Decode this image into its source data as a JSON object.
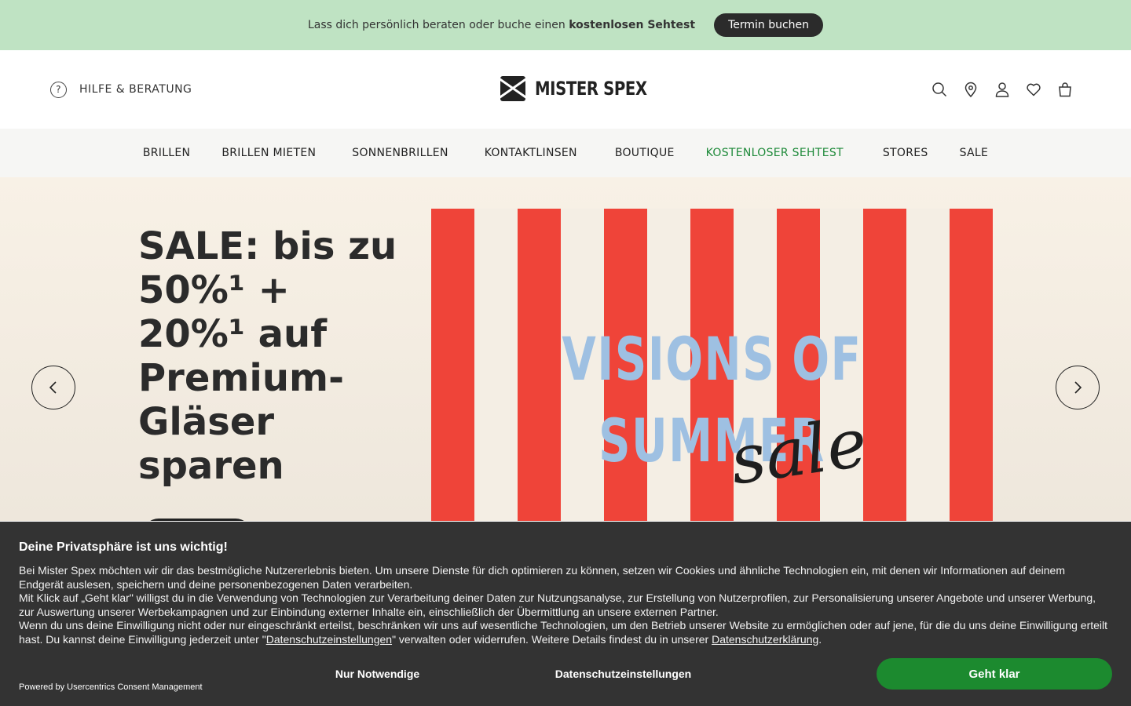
{
  "promo": {
    "text": "Lass dich persönlich beraten oder buche einen",
    "bold": "kostenlosen Sehtest",
    "button": "Termin buchen"
  },
  "header": {
    "help_label": "HILFE & BERATUNG",
    "logo_text": "MISTER SPEX",
    "icons": [
      "search-icon",
      "location-icon",
      "account-icon",
      "wishlist-icon",
      "cart-icon"
    ]
  },
  "nav": {
    "items": [
      {
        "label": "BRILLEN"
      },
      {
        "label": "BRILLEN MIETEN"
      },
      {
        "label": "SONNENBRILLEN"
      },
      {
        "label": "KONTAKTLINSEN"
      },
      {
        "label": "BOUTIQUE"
      },
      {
        "label": "KOSTENLOSER SEHTEST",
        "highlight": "#1f8a3a"
      },
      {
        "label": "STORES"
      },
      {
        "label": "SALE"
      }
    ]
  },
  "hero": {
    "headline": "SALE: bis zu 50%¹ + 20%¹ auf Premium-Gläser sparen",
    "banner_line1": "VISIONS OF",
    "banner_line2": "SUMMER",
    "banner_script": "sale"
  },
  "cookie": {
    "title": "Deine Privatsphäre ist uns wichtig!",
    "p1": "Bei Mister Spex möchten wir dir das bestmögliche Nutzererlebnis bieten. Um unsere Dienste für dich optimieren zu können, setzen wir Cookies und ähnliche Technologien ein, mit denen wir Informationen auf deinem Endgerät auslesen, speichern und deine personenbezogenen Daten verarbeiten.",
    "p2": "Mit Klick auf „Geht klar\" willigst du in die Verwendung von Technologien zur Verarbeitung deiner Daten zur Nutzungsanalyse, zur Erstellung von Nutzerprofilen, zur Personalisierung unserer Angebote und unserer Werbung, zur Auswertung unserer Werbekampagnen und zur Einbindung externer Inhalte ein, einschließlich der Übermittlung an unsere externen Partner.",
    "p3_a": "Wenn du uns deine Einwilligung nicht oder nur eingeschränkt erteilst, beschränken wir uns auf wesentliche Technologien, um den Betrieb unserer Website zu ermöglichen oder auf jene, für die du uns deine Einwilligung erteilt hast. Du kannst deine Einwilligung jederzeit unter \"",
    "p3_link1": "Datenschutzeinstellungen",
    "p3_b": "\" verwalten oder widerrufen. Weitere Details findest du in unserer ",
    "p3_link2": "Datenschutzerklärung",
    "p3_c": ".",
    "powered": "Powered by Usercentrics Consent Management",
    "btn_necessary": "Nur Notwendige",
    "btn_settings": "Datenschutzeinstellungen",
    "btn_accept": "Geht klar"
  },
  "colors": {
    "promo_bg": "#bfe3c3",
    "accent_green": "#1c8a2f",
    "stripe_red": "#ef4439",
    "banner_blue": "#9ec0e2"
  }
}
